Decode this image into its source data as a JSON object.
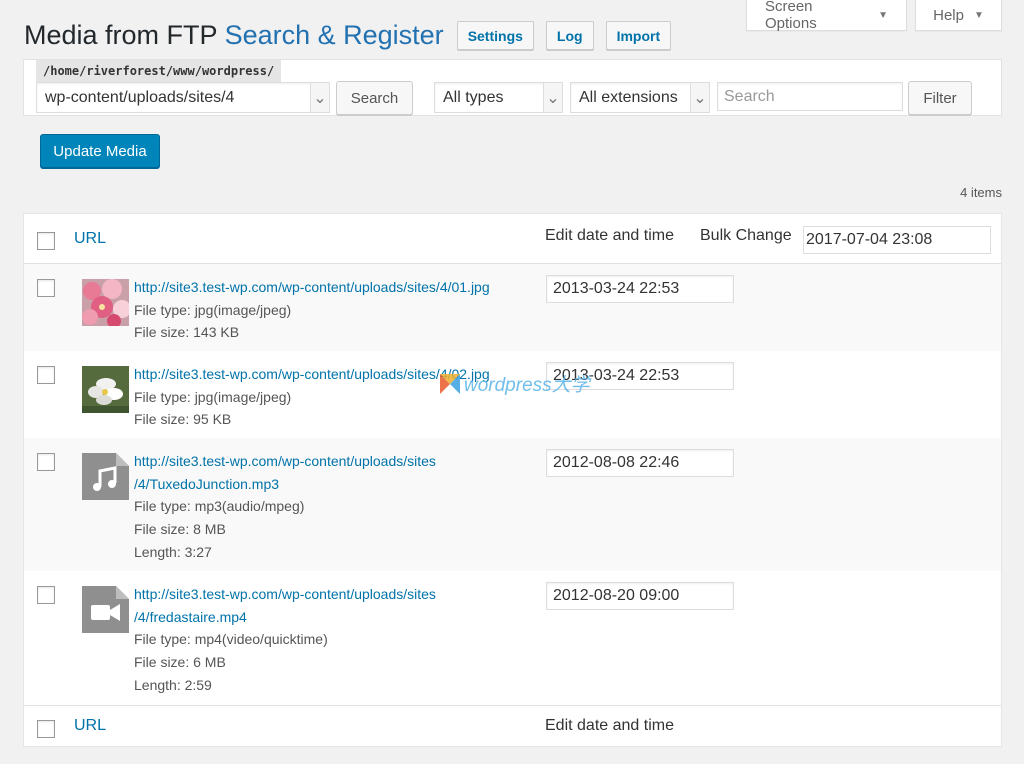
{
  "screen_meta": {
    "screen_options_label": "Screen Options",
    "help_label": "Help"
  },
  "header": {
    "title_plain": "Media from FTP",
    "title_accent": "Search & Register",
    "actions": [
      "Settings",
      "Log",
      "Import"
    ]
  },
  "search": {
    "base_path": "/home/riverforest/www/wordpress/",
    "directory_value": "wp-content/uploads/sites/4",
    "search_button": "Search",
    "type_select": "All types",
    "extension_select": "All extensions",
    "search_placeholder": "Search",
    "filter_button": "Filter"
  },
  "update_button": "Update Media",
  "items_count": "4 items",
  "table": {
    "col_url": "URL",
    "col_date": "Edit date and time",
    "bulk_change_label": "Bulk Change",
    "bulk_change_value": "2017-07-04 23:08",
    "rows": [
      {
        "url_lines": [
          "http://site3.test-wp.com/wp-content/uploads/sites/4/01.jpg"
        ],
        "file_type": "File type: jpg(image/jpeg)",
        "file_size": "File size: 143 KB",
        "length": "",
        "date": "2013-03-24 22:53",
        "thumb": "pink-flowers"
      },
      {
        "url_lines": [
          "http://site3.test-wp.com/wp-content/uploads/sites/4/02.jpg"
        ],
        "file_type": "File type: jpg(image/jpeg)",
        "file_size": "File size: 95 KB",
        "length": "",
        "date": "2013-03-24 22:53",
        "thumb": "white-flowers"
      },
      {
        "url_lines": [
          "http://site3.test-wp.com/wp-content/uploads/sites",
          "/4/TuxedoJunction.mp3"
        ],
        "file_type": "File type: mp3(audio/mpeg)",
        "file_size": "File size: 8 MB",
        "length": "Length: 3:27",
        "date": "2012-08-08 22:46",
        "thumb": "audio-file-icon"
      },
      {
        "url_lines": [
          "http://site3.test-wp.com/wp-content/uploads/sites",
          "/4/fredastaire.mp4"
        ],
        "file_type": "File type: mp4(video/quicktime)",
        "file_size": "File size: 6 MB",
        "length": "Length: 2:59",
        "date": "2012-08-20 09:00",
        "thumb": "video-file-icon"
      }
    ]
  },
  "watermark": "wordpress大学",
  "colors": {
    "accent": "#2271b1",
    "link": "#0073aa",
    "primary_button": "#0085ba",
    "background": "#f1f1f1"
  }
}
